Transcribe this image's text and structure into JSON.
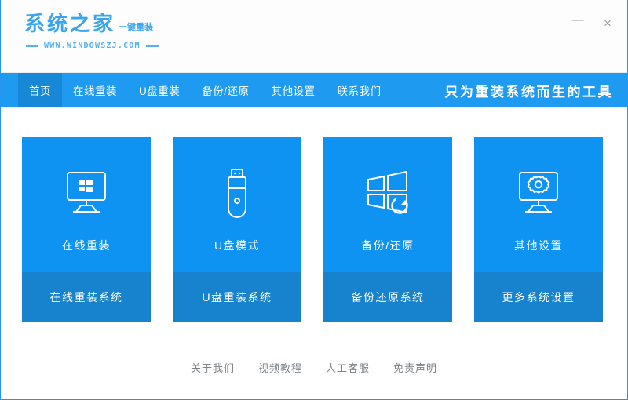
{
  "window": {
    "accent_color": "#1e9bf0",
    "card_color": "#0e93f2",
    "card_footer_color": "#1782cd",
    "minimize_label": "—",
    "close_label": "×"
  },
  "logo": {
    "main": "系统之家",
    "sub": "一键重装",
    "url": "WWW.WINDOWSZJ.COM"
  },
  "nav": {
    "items": [
      {
        "label": "首页",
        "active": true
      },
      {
        "label": "在线重装",
        "active": false
      },
      {
        "label": "U盘重装",
        "active": false
      },
      {
        "label": "备份/还原",
        "active": false
      },
      {
        "label": "其他设置",
        "active": false
      },
      {
        "label": "联系我们",
        "active": false
      }
    ],
    "slogan": "只为重装系统而生的工具"
  },
  "cards": [
    {
      "icon": "monitor-windows-icon",
      "title": "在线重装",
      "footer": "在线重装系统"
    },
    {
      "icon": "usb-drive-icon",
      "title": "U盘模式",
      "footer": "U盘重装系统"
    },
    {
      "icon": "windows-restore-icon",
      "title": "备份/还原",
      "footer": "备份还原系统"
    },
    {
      "icon": "monitor-gear-icon",
      "title": "其他设置",
      "footer": "更多系统设置"
    }
  ],
  "footer_links": [
    {
      "label": "关于我们"
    },
    {
      "label": "视频教程"
    },
    {
      "label": "人工客服"
    },
    {
      "label": "免责声明"
    }
  ]
}
